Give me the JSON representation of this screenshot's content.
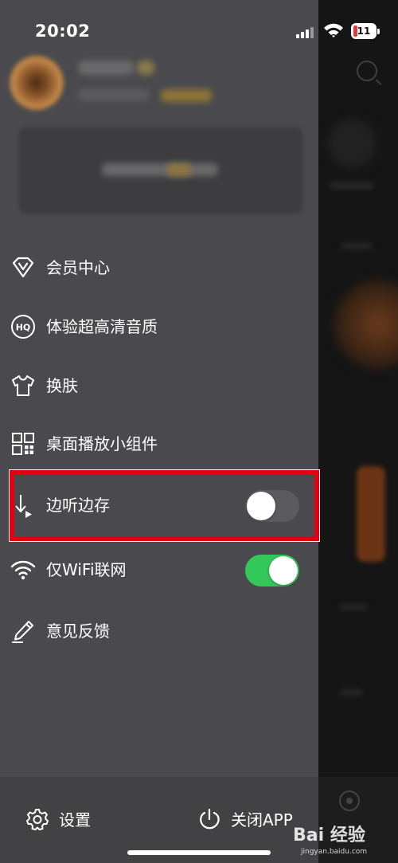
{
  "status_bar": {
    "time": "20:02",
    "battery": "11"
  },
  "menu": [
    {
      "id": "vip",
      "label": "会员中心",
      "icon": "vip-v-icon"
    },
    {
      "id": "hq",
      "label": "体验超高清音质",
      "icon": "hq-icon"
    },
    {
      "id": "skin",
      "label": "换肤",
      "icon": "tshirt-icon"
    },
    {
      "id": "widget",
      "label": "桌面播放小组件",
      "icon": "widget-grid-icon"
    },
    {
      "id": "cache",
      "label": "边听边存",
      "icon": "download-play-icon",
      "toggle": false
    },
    {
      "id": "wifi",
      "label": "仅WiFi联网",
      "icon": "wifi-icon",
      "toggle": true
    },
    {
      "id": "feedback",
      "label": "意见反馈",
      "icon": "pen-icon"
    }
  ],
  "footer": {
    "settings_label": "设置",
    "close_app_label": "关闭APP"
  },
  "watermark": {
    "brand": "Bai 经验",
    "site": "jingyan.baidu.com"
  },
  "colors": {
    "drawer_bg": "#4a4a4e",
    "toggle_on": "#34c759",
    "toggle_off": "#5b5b5f",
    "highlight": "#e3000f"
  }
}
